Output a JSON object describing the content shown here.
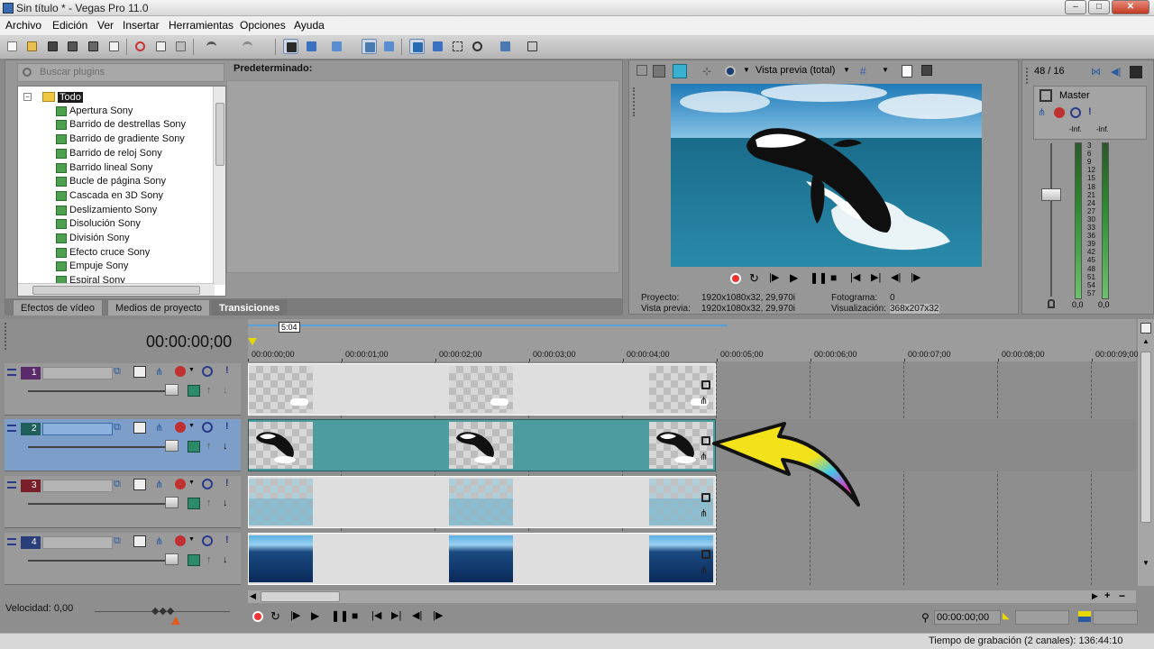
{
  "window": {
    "title": "Sin título * - Vegas Pro 11.0",
    "min": "–",
    "max": "□",
    "close": "✕"
  },
  "menu": [
    "Archivo",
    "Edición",
    "Ver",
    "Insertar",
    "Herramientas",
    "Opciones",
    "Ayuda"
  ],
  "explorer": {
    "search_placeholder": "Buscar plugins",
    "root": "Todo",
    "items": [
      "Apertura Sony",
      "Barrido de destrellas Sony",
      "Barrido de gradiente Sony",
      "Barrido de reloj Sony",
      "Barrido lineal Sony",
      "Bucle de página Sony",
      "Cascada en 3D Sony",
      "Deslizamiento Sony",
      "Disolución Sony",
      "División Sony",
      "Efecto cruce Sony",
      "Empuje Sony",
      "Espiral Sony"
    ],
    "preset_label": "Predeterminado:",
    "tabs": [
      "Efectos de vídeo",
      "Medios de proyecto",
      "Transiciones"
    ],
    "active_tab": "Transiciones"
  },
  "preview": {
    "mode": "Vista previa (total)",
    "info": {
      "proyecto_label": "Proyecto:",
      "proyecto_value": "1920x1080x32, 29,970i",
      "vista_label": "Vista previa:",
      "vista_value": "1920x1080x32, 29,970i",
      "fotograma_label": "Fotograma:",
      "fotograma_value": "0",
      "visual_label": "Visualización:",
      "visual_value": "368x207x32"
    }
  },
  "mixer": {
    "count": "48 / 16",
    "master_label": "Master",
    "inf_left": "-Inf.",
    "inf_right": "-Inf.",
    "scale": [
      "3",
      "6",
      "9",
      "12",
      "15",
      "18",
      "21",
      "24",
      "27",
      "30",
      "33",
      "36",
      "39",
      "42",
      "45",
      "48",
      "51",
      "54",
      "57"
    ],
    "val_left": "0,0",
    "val_right": "0,0"
  },
  "timeline": {
    "timecode": "00:00:00;00",
    "loop_length": "5:04",
    "ruler": [
      "00:00:00;00",
      "00:00:01;00",
      "00:00:02;00",
      "00:00:03;00",
      "00:00:04;00",
      "00:00:05;00",
      "00:00:06;00",
      "00:00:07;00",
      "00:00:08;00",
      "00:00:09;00"
    ],
    "tracks": [
      {
        "num": "1",
        "color": "#5a2a6a",
        "selected": false
      },
      {
        "num": "2",
        "color": "#1f5e5a",
        "selected": true
      },
      {
        "num": "3",
        "color": "#7a1f2a",
        "selected": false
      },
      {
        "num": "4",
        "color": "#2a3f7a",
        "selected": false
      }
    ],
    "speed": "Velocidad: 0,00",
    "cursor_time": "00:00:00;00"
  },
  "status": {
    "record_time": "Tiempo de grabación (2 canales): 136:44:10"
  },
  "colors": {
    "accent": "#4d9ca0",
    "arrow": "#f3e21a",
    "selected_track": "#7c9ec8"
  }
}
